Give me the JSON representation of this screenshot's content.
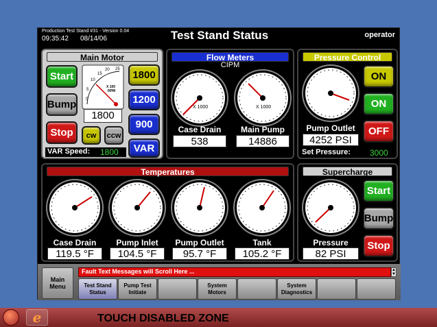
{
  "header": {
    "station": "Production Test Stand #31 - Version 0.04",
    "time": "09:35:42",
    "date": "08/14/06",
    "title": "Test Stand Status",
    "user": "operator"
  },
  "main_motor": {
    "title": "Main Motor",
    "start": "Start",
    "bump": "Bump",
    "stop": "Stop",
    "cw": "cw",
    "ccw": "ccw",
    "speed_buttons": [
      "1800",
      "1200",
      "900",
      "VAR"
    ],
    "gauge_ticks": [
      "0",
      "5",
      "10",
      "15",
      "20",
      "25"
    ],
    "gauge_unit1": "X 100",
    "gauge_unit2": "RPM",
    "rpm_value": "1800",
    "var_speed_label": "VAR Speed:",
    "var_speed_value": "1800"
  },
  "flow_meters": {
    "title": "Flow Meters",
    "unit": "CIPM",
    "case_drain": {
      "label": "Case Drain",
      "value": "538",
      "multiplier": "X 1000"
    },
    "main_pump": {
      "label": "Main Pump",
      "value": "14886",
      "multiplier": "X 1000"
    }
  },
  "pressure_control": {
    "title": "Pressure Control",
    "on_yellow": "ON",
    "on_green": "ON",
    "off": "OFF",
    "pump_outlet_label": "Pump Outlet",
    "pump_outlet_value": "4252 PSI",
    "set_pressure_label": "Set Pressure:",
    "set_pressure_value": "3000"
  },
  "temperatures": {
    "title": "Temperatures",
    "gauges": [
      {
        "label": "Case Drain",
        "value": "119.5 °F"
      },
      {
        "label": "Pump Inlet",
        "value": "104.5 °F"
      },
      {
        "label": "Pump Outlet",
        "value": "95.7 °F"
      },
      {
        "label": "Tank",
        "value": "105.2 °F"
      }
    ]
  },
  "supercharge": {
    "title": "Supercharge",
    "start": "Start",
    "bump": "Bump",
    "stop": "Stop",
    "pressure_label": "Pressure",
    "pressure_value": "82 PSI"
  },
  "fault_bar": {
    "message": "Fault Text Messages will Scroll Here ..."
  },
  "nav": {
    "main_menu": "Main Menu",
    "test_stand_status": "Test Stand Status",
    "pump_test_initiate": "Pump Test Initiate",
    "system_motors": "System Motors",
    "system_diagnostics": "System Diagnostics"
  },
  "taskbar": {
    "zone_text": "TOUCH DISABLED ZONE"
  },
  "colors": {
    "green": "#21b021",
    "red": "#d01818",
    "blue": "#1a2fd0",
    "yellow": "#c8c800",
    "grey": "#a8a8a8"
  }
}
